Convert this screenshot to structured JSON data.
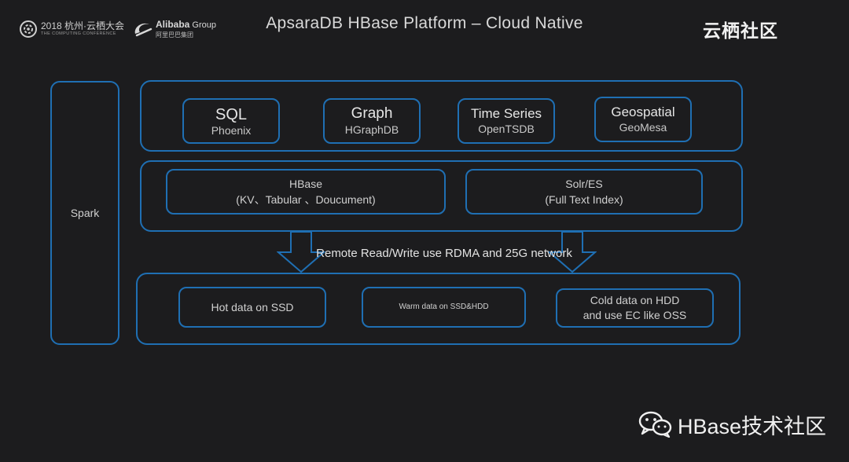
{
  "header": {
    "title": "ApsaraDB HBase Platform – Cloud Native",
    "conference": {
      "year_text": "2018 杭州·云栖大会",
      "subtitle": "THE COMPUTING CONFERENCE"
    },
    "alibaba": {
      "name": "Alibaba",
      "group": " Group",
      "cn": "阿里巴巴集团"
    },
    "community_logo": "云栖社区"
  },
  "diagram": {
    "spark": "Spark",
    "query_layer": [
      {
        "title": "SQL",
        "subtitle": "Phoenix"
      },
      {
        "title": "Graph",
        "subtitle": "HGraphDB"
      },
      {
        "title": "Time Series",
        "subtitle": "OpenTSDB"
      },
      {
        "title": "Geospatial",
        "subtitle": "GeoMesa"
      }
    ],
    "storage_layer": [
      {
        "line1": "HBase",
        "line2": "(KV、Tabular 、Doucument)"
      },
      {
        "line1": "Solr/ES",
        "line2": "(Full Text Index)"
      }
    ],
    "network_label": "Remote Read/Write  use RDMA and 25G network",
    "data_layer": [
      {
        "line1": "Hot data on SSD",
        "line2": ""
      },
      {
        "line1": "Warm data on SSD&HDD",
        "line2": ""
      },
      {
        "line1": "Cold data on HDD",
        "line2": "and use EC like OSS"
      }
    ]
  },
  "watermark": "HBase技术社区",
  "colors": {
    "background": "#1c1c1e",
    "border": "#1f6fb3",
    "text": "#d8d8d8"
  },
  "icons": [
    "conference-logo-icon",
    "alibaba-logo-icon",
    "yunqi-community-logo-icon",
    "wechat-icon",
    "down-arrow-icon"
  ]
}
